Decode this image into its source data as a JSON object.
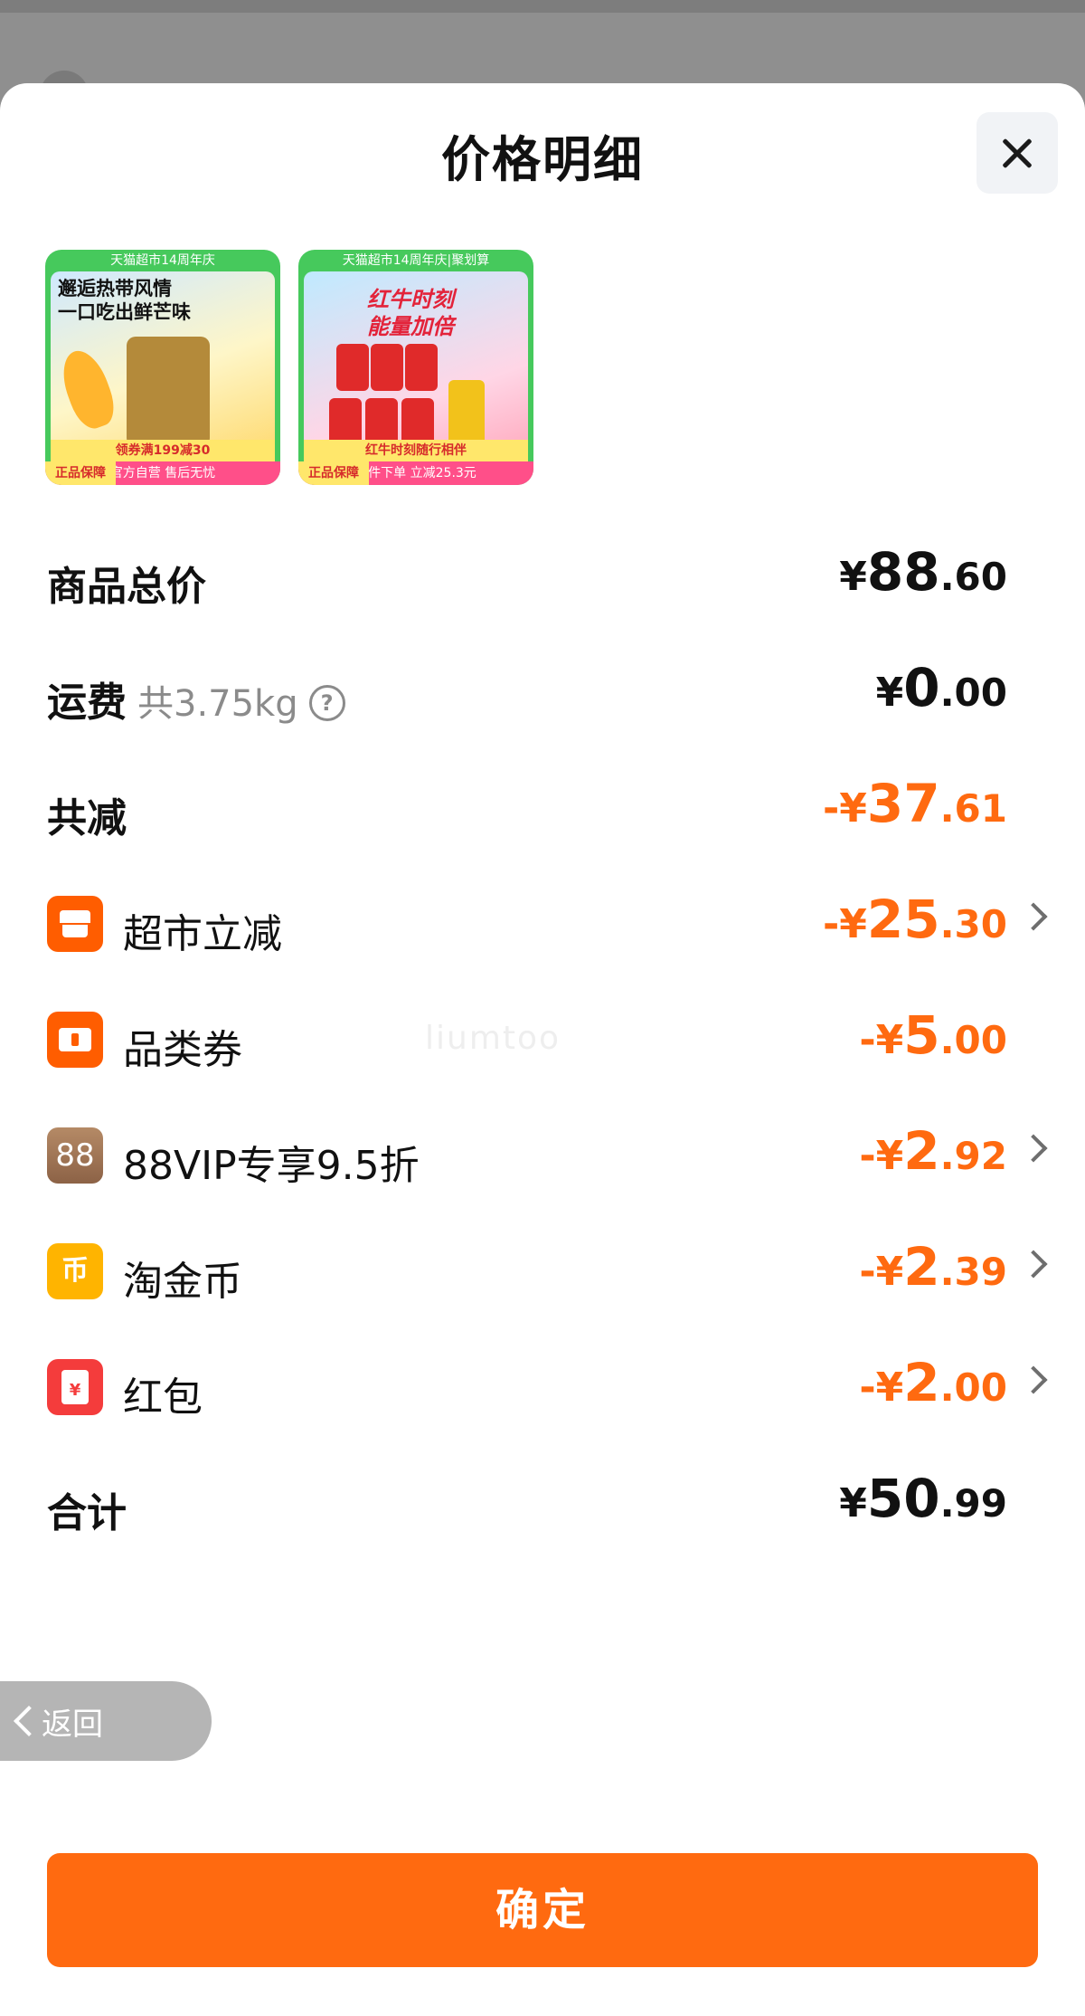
{
  "header": {
    "title": "价格明细"
  },
  "products": [
    {
      "top_strip": "天猫超市14周年庆",
      "headline": "邂逅热带风情\n一口吃出鲜芒味",
      "banner": "领券满199减30",
      "tag": "正品保障",
      "footer": "官方自营 售后无忧"
    },
    {
      "top_strip": "天猫超市14周年庆|聚划算",
      "headline": "红牛时刻\n能量加倍",
      "banner": "红牛时刻随行相伴",
      "tag": "正品保障",
      "footer": "单件下单 立减25.3元"
    }
  ],
  "rows": {
    "subtotal": {
      "label": "商品总价",
      "yen": "¥",
      "int": "88",
      "dec": ".60"
    },
    "shipping": {
      "label": "运费",
      "sub": "共3.75kg",
      "help": "?",
      "yen": "¥",
      "int": "0",
      "dec": ".00"
    },
    "total_discount": {
      "label": "共减",
      "yen": "-¥",
      "int": "37",
      "dec": ".61"
    },
    "discounts": [
      {
        "icon": "shop-icon",
        "label": "超市立减",
        "yen": "-¥",
        "int": "25",
        "dec": ".30",
        "has_chevron": true
      },
      {
        "icon": "coupon-icon",
        "label": "品类券",
        "yen": "-¥",
        "int": "5",
        "dec": ".00",
        "has_chevron": false
      },
      {
        "icon": "vip-icon",
        "icon_text": "88",
        "label": "88VIP专享9.5折",
        "yen": "-¥",
        "int": "2",
        "dec": ".92",
        "has_chevron": true
      },
      {
        "icon": "gold-coin-icon",
        "icon_text": "币",
        "label": "淘金币",
        "yen": "-¥",
        "int": "2",
        "dec": ".39",
        "has_chevron": true
      },
      {
        "icon": "red-envelope-icon",
        "icon_text": "¥",
        "label": "红包",
        "yen": "-¥",
        "int": "2",
        "dec": ".00",
        "has_chevron": true
      }
    ],
    "grand_total": {
      "label": "合计",
      "yen": "¥",
      "int": "50",
      "dec": ".99"
    }
  },
  "watermark": "liumtoo",
  "back_button": {
    "label": "返回"
  },
  "confirm_button": {
    "label": "确定"
  },
  "colors": {
    "accent": "#ff6a10",
    "text": "#111111",
    "muted": "#8b8b8b"
  }
}
